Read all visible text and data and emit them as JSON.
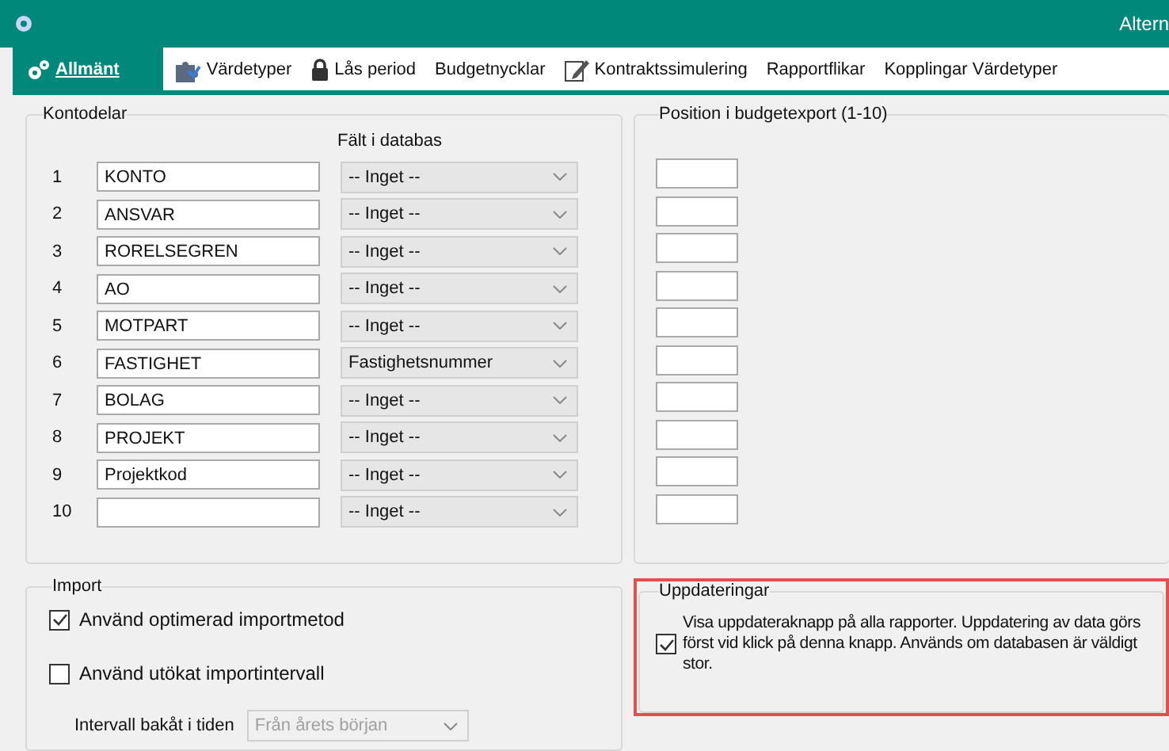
{
  "window": {
    "title": "Altern"
  },
  "tabs": [
    {
      "label": "Allmänt",
      "selected": true
    },
    {
      "label": "Värdetyper",
      "selected": false
    },
    {
      "label": "Lås period",
      "selected": false
    },
    {
      "label": "Budgetnycklar",
      "selected": false
    },
    {
      "label": "Kontraktssimulering",
      "selected": false
    },
    {
      "label": "Rapportflikar",
      "selected": false
    },
    {
      "label": "Kopplingar Värdetyper",
      "selected": false
    }
  ],
  "kontodelar": {
    "title": "Kontodelar",
    "column_header": "Fält i databas",
    "rows": [
      {
        "number": "1",
        "name": "KONTO",
        "field": "-- Inget --"
      },
      {
        "number": "2",
        "name": "ANSVAR",
        "field": "-- Inget --"
      },
      {
        "number": "3",
        "name": "RORELSEGREN",
        "field": "-- Inget --"
      },
      {
        "number": "4",
        "name": "AO",
        "field": "-- Inget --"
      },
      {
        "number": "5",
        "name": "MOTPART",
        "field": "-- Inget --"
      },
      {
        "number": "6",
        "name": "FASTIGHET",
        "field": "Fastighetsnummer"
      },
      {
        "number": "7",
        "name": "BOLAG",
        "field": "-- Inget --"
      },
      {
        "number": "8",
        "name": "PROJEKT",
        "field": "-- Inget --"
      },
      {
        "number": "9",
        "name": "Projektkod",
        "field": "-- Inget --"
      },
      {
        "number": "10",
        "field": "-- Inget --"
      }
    ]
  },
  "position": {
    "title": "Position i budgetexport (1-10)"
  },
  "import": {
    "title": "Import",
    "options": [
      {
        "label": "Använd optimerad importmetod",
        "checked": true
      },
      {
        "label": "Använd utökat importintervall",
        "checked": false
      }
    ],
    "interval": {
      "label": "Intervall bakåt i tiden",
      "value": "Från årets början",
      "disabled": true
    }
  },
  "updates": {
    "title": "Uppdateringar",
    "highlighted": true,
    "option": {
      "label": "Visa uppdateraknapp på alla rapporter. Uppdatering av data görs först vid klick på denna knapp. Används om databasen är väldigt stor.",
      "checked": true
    }
  }
}
